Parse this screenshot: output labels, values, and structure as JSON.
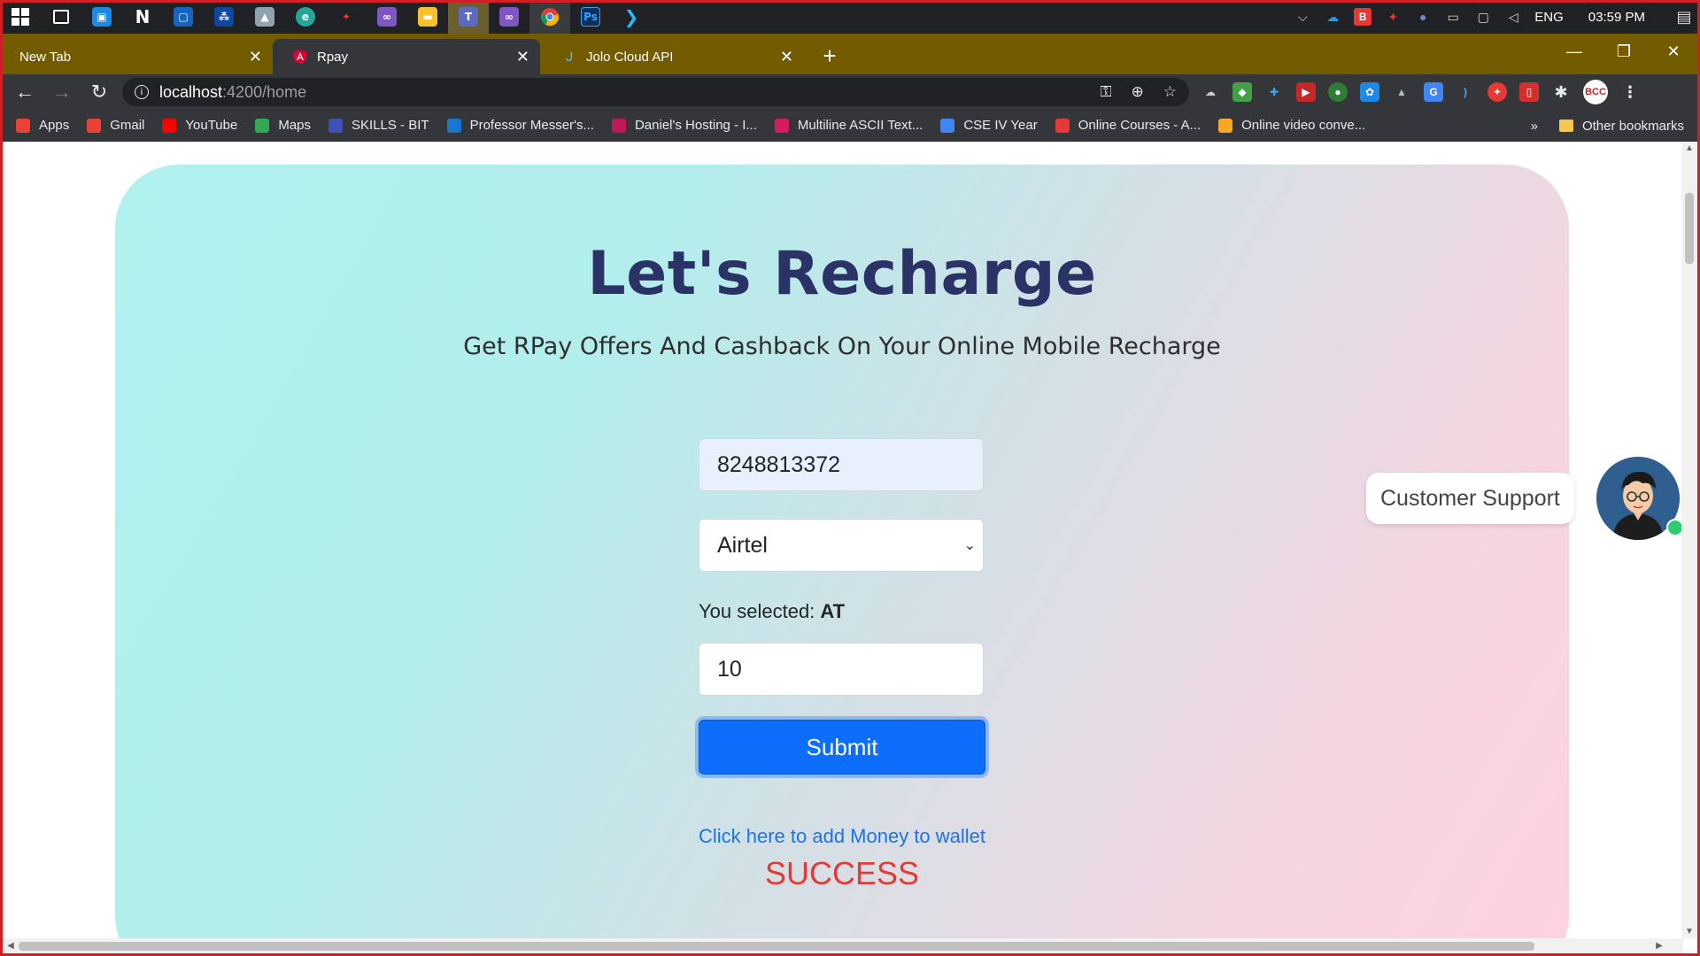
{
  "taskbar": {
    "icons": [
      "windows-start",
      "task-view",
      "notion",
      "app-1",
      "app-2",
      "app-3",
      "photos",
      "edge",
      "app-4",
      "visual-studio",
      "file-explorer",
      "teams",
      "visual-studio-2",
      "chrome",
      "photoshop",
      "vscode"
    ],
    "tray": {
      "language": "ENG",
      "time": "03:59 PM"
    }
  },
  "tabs": [
    {
      "title": "New Tab",
      "favicon": ""
    },
    {
      "title": "Rpay",
      "favicon": "angular"
    },
    {
      "title": "Jolo Cloud API",
      "favicon": "jolo"
    }
  ],
  "address": {
    "host": "localhost",
    "path": ":4200/home"
  },
  "bookmarks": [
    {
      "label": "Apps",
      "color": "#ea4335"
    },
    {
      "label": "Gmail",
      "color": "#ea4335"
    },
    {
      "label": "YouTube",
      "color": "#ff0000"
    },
    {
      "label": "Maps",
      "color": "#34a853"
    },
    {
      "label": "SKILLS - BIT",
      "color": "#3f51b5"
    },
    {
      "label": "Professor Messer's...",
      "color": "#1976d2"
    },
    {
      "label": "Daniel's Hosting - I...",
      "color": "#c2185b"
    },
    {
      "label": "Multiline ASCII Text...",
      "color": "#d81b60"
    },
    {
      "label": "CSE IV Year",
      "color": "#4285f4"
    },
    {
      "label": "Online Courses - A...",
      "color": "#e53935"
    },
    {
      "label": "Online video conve...",
      "color": "#f9a825"
    }
  ],
  "bookmarks_more": "»",
  "other_bookmarks": "Other bookmarks",
  "page": {
    "title": "Let's Recharge",
    "subtitle": "Get RPay Offers And Cashback On Your Online Mobile Recharge",
    "phone_value": "8248813372",
    "operator_value": "Airtel",
    "selected_prefix": "You selected: ",
    "selected_code": "AT",
    "amount_value": "10",
    "submit_label": "Submit",
    "wallet_link": "Click here to add Money to wallet",
    "status": "SUCCESS",
    "support_label": "Customer Support"
  },
  "profile_initials": "BCC",
  "colors": {
    "accent": "#0d6efd",
    "title": "#2b3266",
    "success": "#e53935",
    "link": "#1a73e8"
  }
}
